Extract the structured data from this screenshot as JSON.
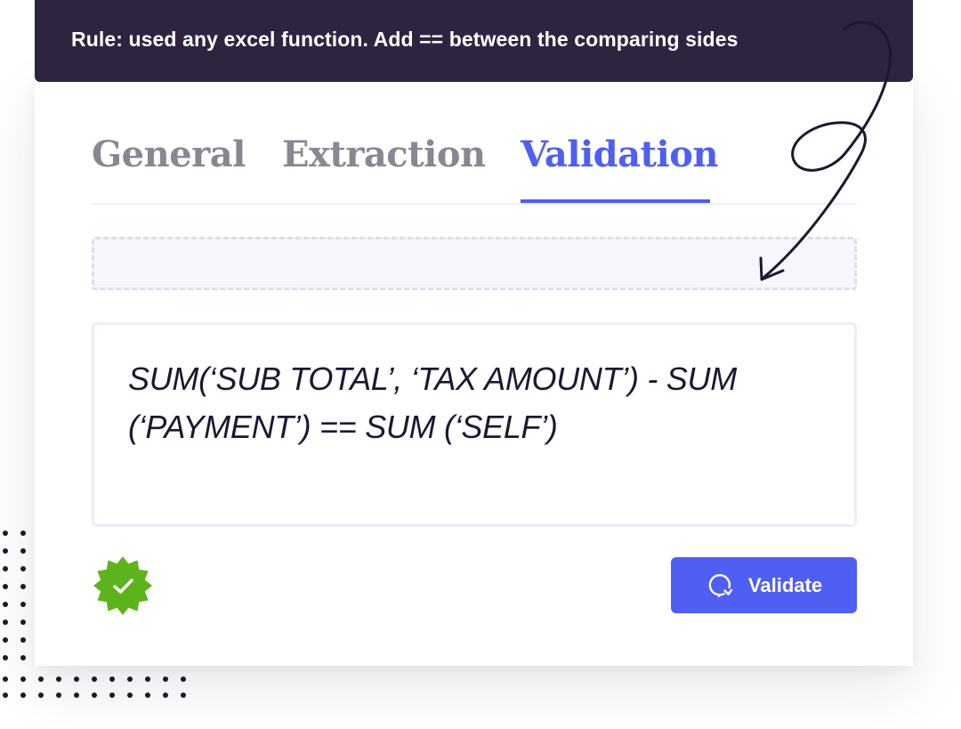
{
  "rule": {
    "text": "Rule: used any excel function. Add == between the comparing sides"
  },
  "tabs": [
    {
      "label": "General",
      "active": false
    },
    {
      "label": "Extraction",
      "active": false
    },
    {
      "label": "Validation",
      "active": true
    }
  ],
  "formula": {
    "value": "SUM(‘SUB TOTAL’, ‘TAX AMOUNT’) - SUM\n(‘PAYMENT’) == SUM (‘SELF’)"
  },
  "status": {
    "icon": "verified-check-icon",
    "color": "#5db31b"
  },
  "actions": {
    "validate_label": "Validate",
    "validate_icon": "refresh-icon"
  },
  "colors": {
    "accent": "#4f5ff1",
    "banner": "#2f2440",
    "text": "#1d1730",
    "muted_tab": "#8a8792"
  }
}
